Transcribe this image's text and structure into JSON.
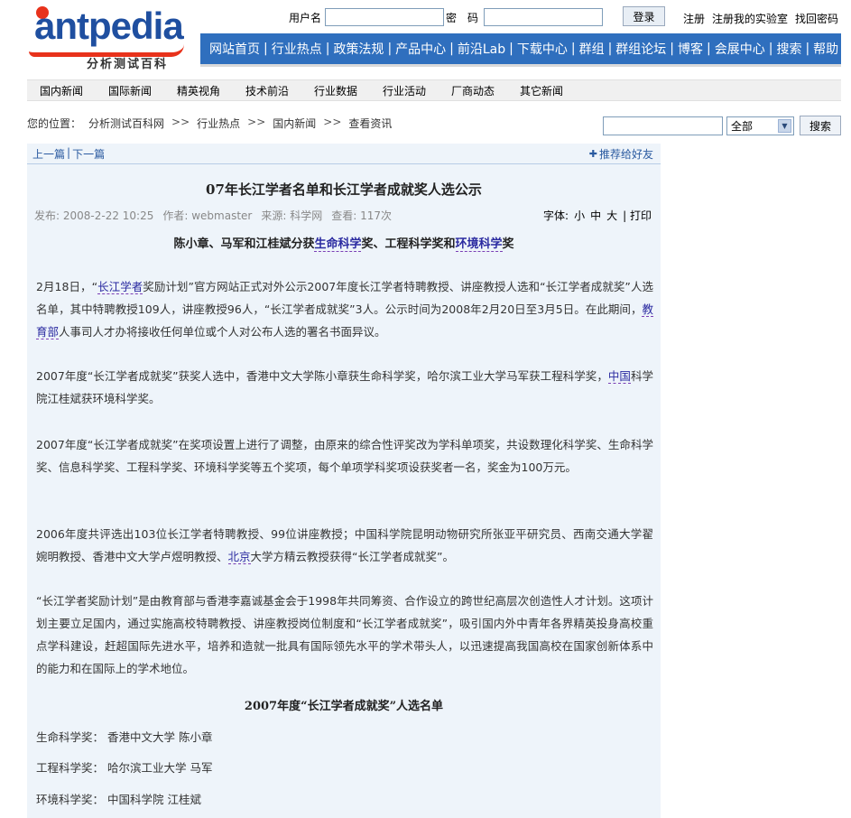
{
  "logo": {
    "wordmark": "antpedia",
    "subtitle": "分析测试百科"
  },
  "login": {
    "username_label": "用户名",
    "password_label": "密　码",
    "username_value": "",
    "password_value": "",
    "submit": "登录"
  },
  "top_links": [
    "注册",
    "注册我的实验室",
    "找回密码"
  ],
  "main_nav": [
    "网站首页",
    "行业热点",
    "政策法规",
    "产品中心",
    "前沿Lab",
    "下载中心",
    "群组",
    "群组论坛",
    "博客",
    "会展中心",
    "搜索",
    "帮助"
  ],
  "sub_nav": [
    "国内新闻",
    "国际新闻",
    "精英视角",
    "技术前沿",
    "行业数据",
    "行业活动",
    "厂商动态",
    "其它新闻"
  ],
  "breadcrumb": {
    "prefix": "您的位置：",
    "items": [
      "分析测试百科网",
      "行业热点",
      "国内新闻",
      "查看资讯"
    ],
    "separator": ">>"
  },
  "search": {
    "value": "",
    "select_value": "全部",
    "button": "搜索"
  },
  "article_nav": {
    "prev": "上一篇",
    "next": "下一篇",
    "separator": "|",
    "share": "推荐给好友"
  },
  "article": {
    "title": "07年长江学者名单和长江学者成就奖人选公示",
    "meta": {
      "published": "发布: 2008-2-22 10:25",
      "author": "作者: webmaster",
      "source": "来源: 科学网",
      "views": "查看: 117次"
    },
    "font_label": "字体:",
    "font_sizes": [
      "小",
      "中",
      "大"
    ],
    "print": "| 打印",
    "lead": {
      "t1": "陈小章、马军和江桂斌分获",
      "k1": "生命科学",
      "t2": "奖、工程科学奖和",
      "k2": "环境科学",
      "t3": "奖"
    },
    "p1": {
      "t1": "2月18日，“",
      "k1": "长江学者",
      "t2": "奖励计划”官方网站正式对外公示2007年度长江学者特聘教授、讲座教授人选和“长江学者成就奖”人选名单，其中特聘教授109人，讲座教授96人，“长江学者成就奖”3人。公示时间为2008年2月20日至3月5日。在此期间，",
      "k2": "教育部",
      "t3": "人事司人才办将接收任何单位或个人对公布人选的署名书面异议。"
    },
    "p2": {
      "t1": "2007年度“长江学者成就奖”获奖人选中，香港中文大学陈小章获生命科学奖，哈尔滨工业大学马军获工程科学奖，",
      "k1": "中国",
      "t2": "科学院江桂斌获环境科学奖。"
    },
    "p3": "2007年度“长江学者成就奖”在奖项设置上进行了调整，由原来的综合性评奖改为学科单项奖，共设数理化科学奖、生命科学奖、信息科学奖、工程科学奖、环境科学奖等五个奖项，每个单项学科奖项设获奖者一名，奖金为100万元。",
    "p4": {
      "t1": "2006年度共评选出103位长江学者特聘教授、99位讲座教授；中国科学院昆明动物研究所张亚平研究员、西南交通大学翟婉明教授、香港中文大学卢煜明教授、",
      "k1": "北京",
      "t2": "大学方精云教授获得“长江学者成就奖”。"
    },
    "p5": "“长江学者奖励计划”是由教育部与香港李嘉诚基金会于1998年共同筹资、合作设立的跨世纪高层次创造性人才计划。这项计划主要立足国内，通过实施高校特聘教授、讲座教授岗位制度和“长江学者成就奖”，吸引国内外中青年各界精英投身高校重点学科建设，赶超国际先进水平，培养和造就一批具有国际领先水平的学术带头人，以迅速提高我国高校在国家创新体系中的能力和在国际上的学术地位。",
    "list_title": "2007年度“长江学者成就奖”人选名单",
    "list": [
      "生命科学奖： 香港中文大学 陈小章",
      "工程科学奖： 哈尔滨工业大学 马军",
      "环境科学奖： 中国科学院 江桂斌"
    ]
  }
}
